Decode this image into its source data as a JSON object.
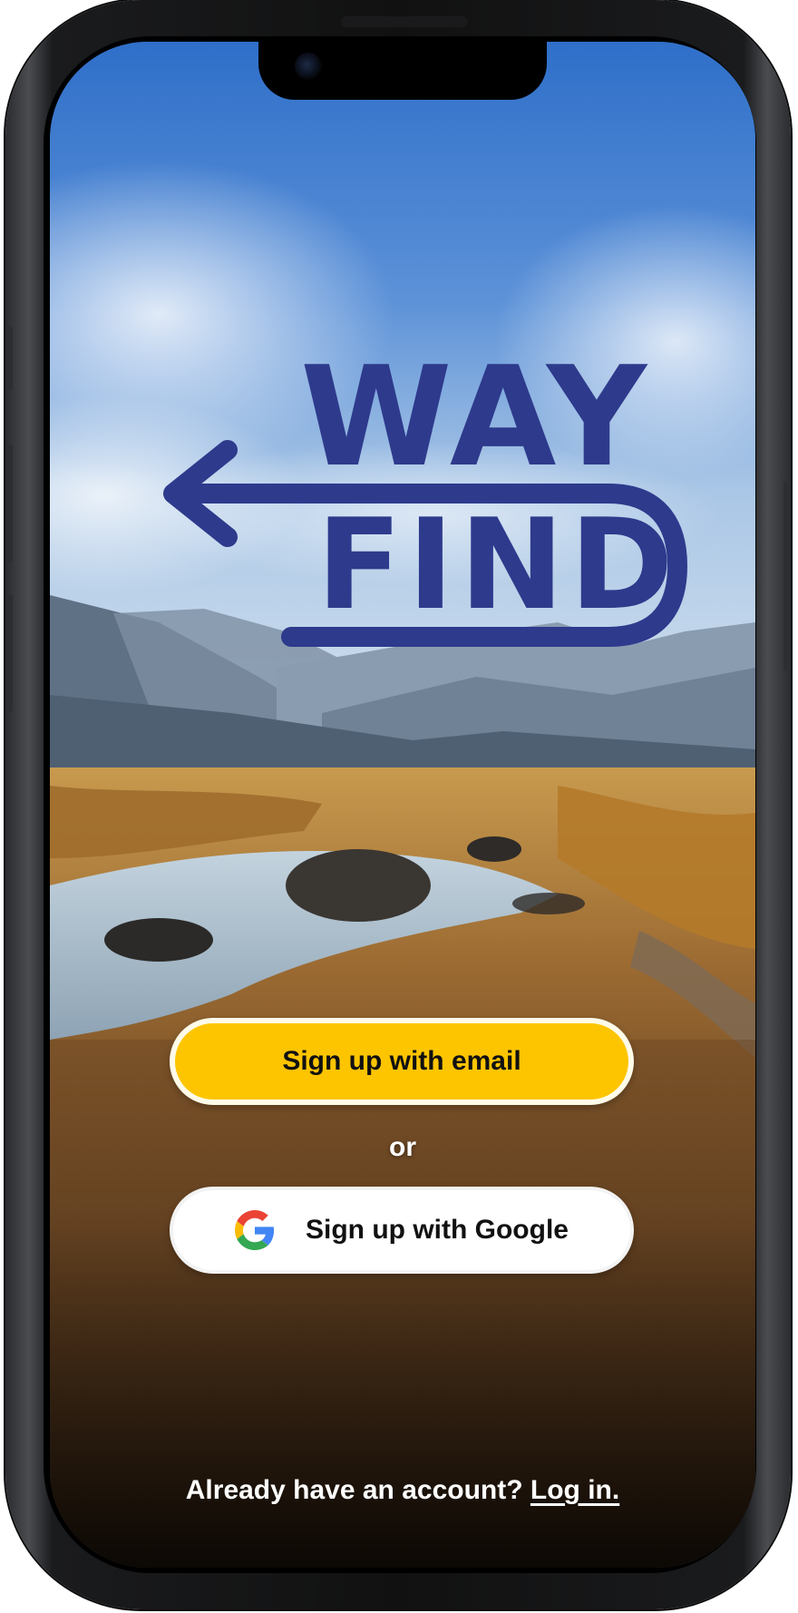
{
  "app": {
    "logo_top": "WAY",
    "logo_bottom": "FIND"
  },
  "actions": {
    "email_signup_label": "Sign up with email",
    "divider_label": "or",
    "google_signup_label": "Sign up with Google"
  },
  "footer": {
    "prompt": "Already have an account?",
    "login_link": "Log in."
  },
  "icons": {
    "google": "google-g-icon",
    "arrow": "arrow-left-icon",
    "camera": "front-camera-icon"
  },
  "colors": {
    "brand_blue": "#2e3a8c",
    "primary_button": "#fdc500",
    "secondary_button": "#ffffff"
  }
}
